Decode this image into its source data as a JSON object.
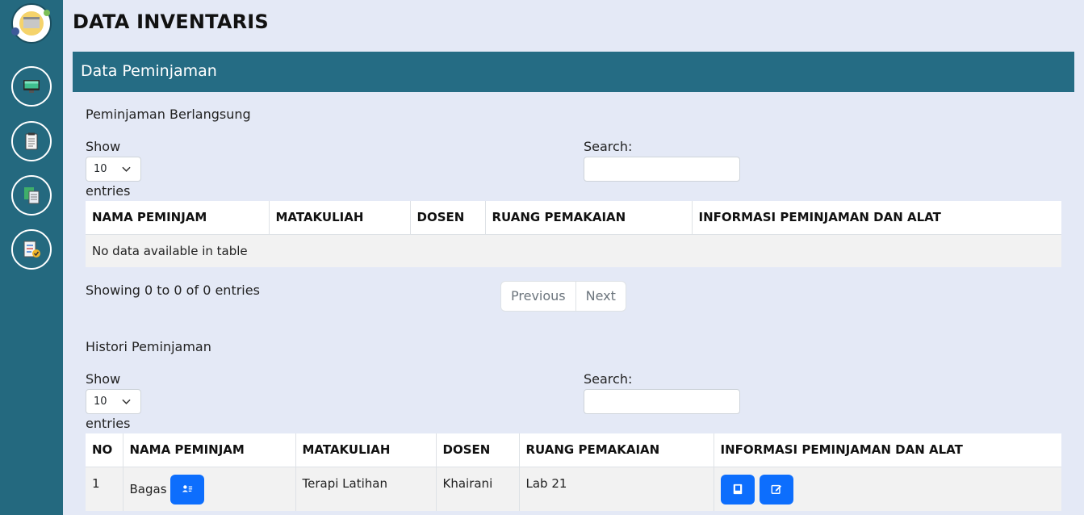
{
  "page": {
    "title": "DATA INVENTARIS"
  },
  "sidebar": {
    "logo_icon": "fisioterapi-logo-icon",
    "items": [
      {
        "icon": "monitor-icon"
      },
      {
        "icon": "clipboard-icon"
      },
      {
        "icon": "documents-icon"
      },
      {
        "icon": "checklist-icon"
      }
    ]
  },
  "panel": {
    "title": "Data Peminjaman"
  },
  "active_loans": {
    "section_title": "Peminjaman Berlangsung",
    "show_label": "Show",
    "entries_value": "10",
    "entries_label": "entries",
    "search_label": "Search:",
    "search_value": "",
    "columns": [
      "NAMA PEMINJAM",
      "MATAKULIAH",
      "DOSEN",
      "RUANG PEMAKAIAN",
      "INFORMASI PEMINJAMAN DAN ALAT"
    ],
    "empty_text": "No data available in table",
    "info_text": "Showing 0 to 0 of 0 entries",
    "previous_label": "Previous",
    "next_label": "Next"
  },
  "history": {
    "section_title": "Histori Peminjaman",
    "show_label": "Show",
    "entries_value": "10",
    "entries_label": "entries",
    "search_label": "Search:",
    "search_value": "",
    "columns": [
      "NO",
      "NAMA PEMINJAM",
      "MATAKULIAH",
      "DOSEN",
      "RUANG PEMAKAIAN",
      "INFORMASI PEMINJAMAN DAN ALAT"
    ],
    "rows": [
      {
        "no": "1",
        "nama": "Bagas",
        "matakuliah": "Terapi Latihan",
        "dosen": "Khairani",
        "ruang": "Lab 21"
      }
    ]
  },
  "colors": {
    "sidebar": "#24697f",
    "panel_header": "#256c84",
    "background": "#e4e9f6",
    "button": "#0d6efd"
  }
}
